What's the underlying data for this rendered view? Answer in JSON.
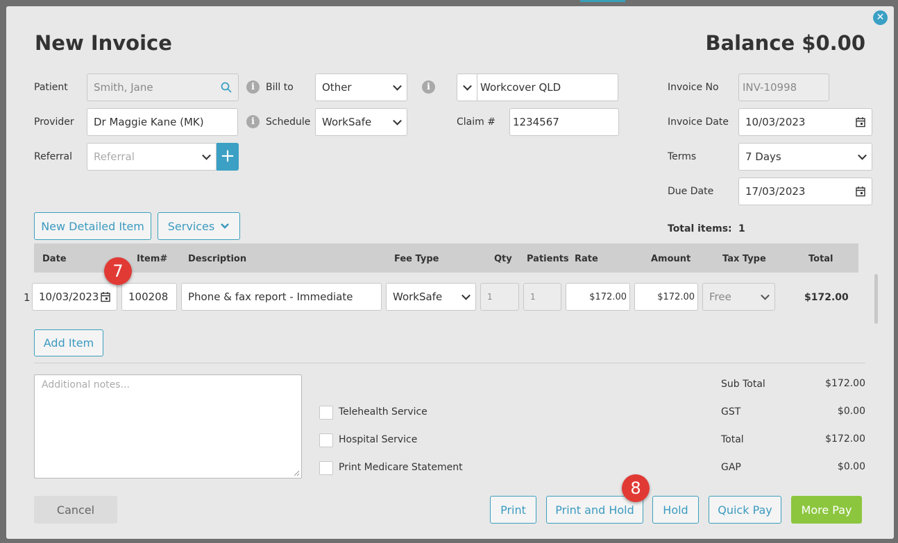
{
  "title": "New Invoice",
  "balance": "Balance $0.00",
  "form": {
    "patient_label": "Patient",
    "patient_value": "Smith, Jane",
    "provider_label": "Provider",
    "provider_value": "Dr Maggie Kane (MK)",
    "referral_label": "Referral",
    "referral_placeholder": "Referral",
    "billto_label": "Bill to",
    "billto_value": "Other",
    "schedule_label": "Schedule",
    "schedule_value": "WorkSafe",
    "payer_value": "Workcover QLD",
    "claim_label": "Claim #",
    "claim_value": "1234567",
    "invoice_no_label": "Invoice No",
    "invoice_no_value": "INV-10998",
    "invoice_date_label": "Invoice Date",
    "invoice_date_value": "10/03/2023",
    "terms_label": "Terms",
    "terms_value": "7 Days",
    "due_date_label": "Due Date",
    "due_date_value": "17/03/2023",
    "total_items_label": "Total items:",
    "total_items_value": "1"
  },
  "buttons": {
    "new_detailed_item": "New Detailed Item",
    "services": "Services",
    "add_item": "Add Item",
    "cancel": "Cancel",
    "print": "Print",
    "print_and_hold": "Print and Hold",
    "hold": "Hold",
    "quick_pay": "Quick Pay",
    "more_pay": "More Pay"
  },
  "table": {
    "headers": {
      "date": "Date",
      "item": "Item#",
      "description": "Description",
      "fee_type": "Fee Type",
      "qty": "Qty",
      "patients": "Patients",
      "rate": "Rate",
      "amount": "Amount",
      "tax_type": "Tax Type",
      "total": "Total"
    },
    "rows": [
      {
        "index": "1",
        "date": "10/03/2023",
        "item": "100208",
        "description": "Phone & fax report - Immediate",
        "fee_type": "WorkSafe",
        "qty": "1",
        "patients": "1",
        "rate": "$172.00",
        "amount": "$172.00",
        "tax_type": "Free",
        "total": "$172.00"
      }
    ]
  },
  "notes_placeholder": "Additional notes...",
  "checkboxes": [
    "Telehealth Service",
    "Hospital Service",
    "Print Medicare Statement"
  ],
  "summary": {
    "subtotal_label": "Sub Total",
    "subtotal_value": "$172.00",
    "gst_label": "GST",
    "gst_value": "$0.00",
    "total_label": "Total",
    "total_value": "$172.00",
    "gap_label": "GAP",
    "gap_value": "$0.00"
  },
  "annotations": {
    "badge7": "7",
    "badge8": "8"
  },
  "colors": {
    "accent": "#3ba0bd",
    "primary_green": "#8cc63f",
    "badge_red": "#e13a35"
  }
}
